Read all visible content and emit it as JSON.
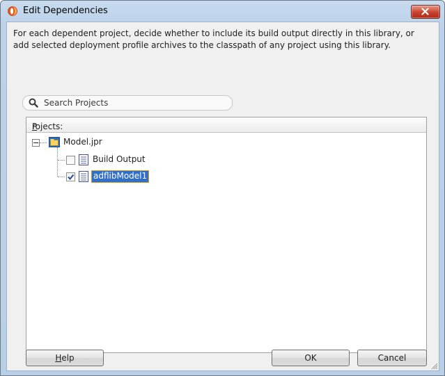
{
  "window": {
    "title": "Edit Dependencies",
    "close_icon": "close-icon",
    "app_icon": "oracle-jdeveloper-icon"
  },
  "description": "For each dependent project, decide whether to include its build output directly in this library, or add selected deployment profile archives to the classpath of any project using this library.",
  "search": {
    "placeholder": "Search Projects",
    "value": "",
    "icon": "search-icon"
  },
  "projects": {
    "header_mnemonic": "P",
    "header_rest": "rojects:",
    "tree": [
      {
        "label": "Model.jpr",
        "icon": "project-folder-icon",
        "expanded": true,
        "children": [
          {
            "label": "Build Output",
            "icon": "document-icon",
            "checked": false,
            "selected": false
          },
          {
            "label": "adflibModel1",
            "icon": "document-icon",
            "checked": true,
            "selected": true
          }
        ]
      }
    ]
  },
  "buttons": {
    "help_mnemonic": "H",
    "help_rest": "elp",
    "ok": "OK",
    "cancel": "Cancel"
  },
  "colors": {
    "selection": "#3170c6",
    "selection_border": "#d69a22",
    "title_gradient": "#c8dbef",
    "close_button": "#c8412c"
  }
}
